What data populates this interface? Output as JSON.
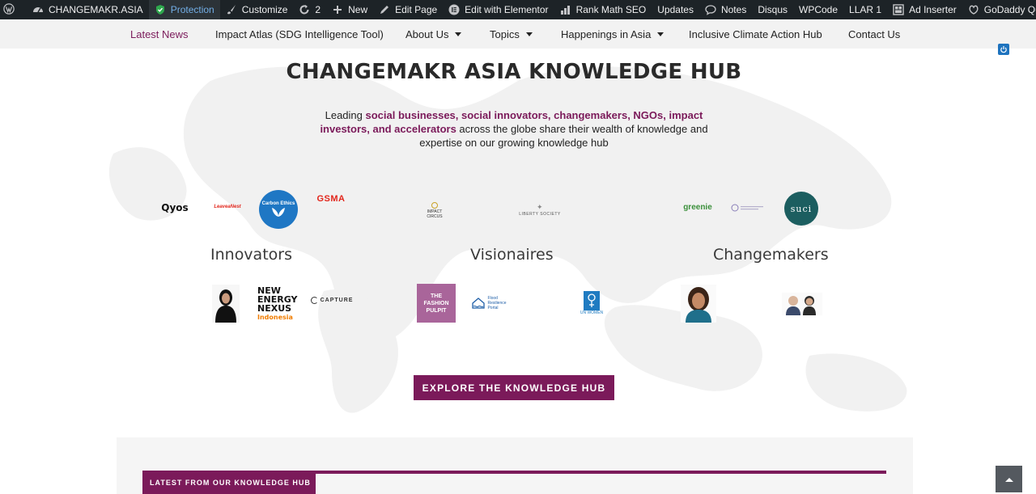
{
  "admin_bar": {
    "items": [
      {
        "label": "",
        "icon": "wordpress-logo-icon"
      },
      {
        "label": "CHANGEMAKR.ASIA",
        "icon": "dashboard-icon"
      },
      {
        "label": "Protection",
        "icon": "shield-check-icon",
        "active": true
      },
      {
        "label": "Customize",
        "icon": "brush-icon"
      },
      {
        "label": "2",
        "icon": "updates-icon"
      },
      {
        "label": "New",
        "icon": "plus-icon"
      },
      {
        "label": "Edit Page",
        "icon": "pencil-icon"
      },
      {
        "label": "Edit with Elementor",
        "icon": "elementor-icon"
      },
      {
        "label": "Rank Math SEO",
        "icon": "rank-math-icon"
      },
      {
        "label": "Updates",
        "icon": ""
      },
      {
        "label": "Notes",
        "icon": "notes-icon"
      },
      {
        "label": "Disqus",
        "icon": ""
      },
      {
        "label": "WPCode",
        "icon": ""
      },
      {
        "label": "LLAR 1",
        "icon": ""
      },
      {
        "label": "Ad Inserter",
        "icon": "ad-inserter-icon"
      },
      {
        "label": "GoDaddy Quick Links",
        "icon": "godaddy-icon"
      }
    ]
  },
  "nav": {
    "items": [
      {
        "label": "Latest News"
      },
      {
        "label": "Impact Atlas (SDG Intelligence Tool)"
      },
      {
        "label": "About Us"
      },
      {
        "label": "Topics"
      },
      {
        "label": "Happenings in Asia"
      },
      {
        "label": "Inclusive Climate Action Hub"
      },
      {
        "label": "Contact Us"
      }
    ]
  },
  "hub": {
    "title": "CHANGEMAKR ASIA KNOWLEDGE HUB",
    "intro_before": "Leading ",
    "intro_highlight": "social businesses, social innovators, changemakers, NGOs, impact investors, and accelerators",
    "intro_after": " across the globe share their wealth of knowledge and expertise on our growing knowledge hub",
    "explore_label": "EXPLORE THE KNOWLEDGE HUB"
  },
  "groups": {
    "innovators": "Innovators",
    "visionaires": "Visionaires",
    "changemakers": "Changemakers"
  },
  "logos": {
    "qyos": "Qyos",
    "leaveanest": "LeaveaNest",
    "carbonethics": "Carbon Ethics",
    "gsma": "GSMA",
    "impact_circus_1": "IMPACT",
    "impact_circus_2": "CIRCUS",
    "liberty_society": "LIBERTY SOCIETY",
    "greenie": "greenie",
    "suci": "suci",
    "nen_1": "NEW",
    "nen_2": "ENERGY",
    "nen_3": "NEXUS",
    "nen_4": "Indonesia",
    "capture": "CAPTURE",
    "fashion_pulpit_1": "THE",
    "fashion_pulpit_2": "FASHION",
    "fashion_pulpit_3": "PULPIT",
    "flood_1": "Flood",
    "flood_2": "Resilience",
    "flood_3": "Portal",
    "unwomen": "UN WOMEN"
  },
  "latest": {
    "label": "LATEST FROM OUR KNOWLEDGE HUB"
  },
  "colors": {
    "brand": "#7b1a5a",
    "admin_bar_bg": "#1d2327",
    "nav_bg": "#f2f2f2"
  }
}
